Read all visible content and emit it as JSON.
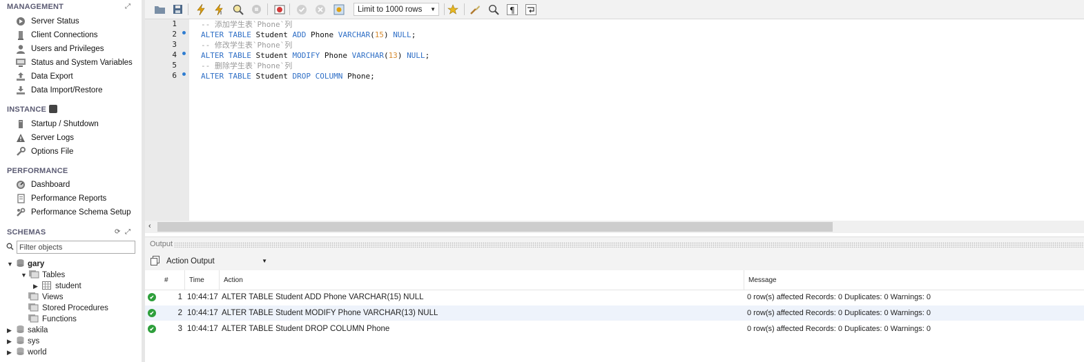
{
  "sidebar": {
    "management": {
      "title": "MANAGEMENT",
      "items": [
        "Server Status",
        "Client Connections",
        "Users and Privileges",
        "Status and System Variables",
        "Data Export",
        "Data Import/Restore"
      ]
    },
    "instance": {
      "title": "INSTANCE",
      "items": [
        "Startup / Shutdown",
        "Server Logs",
        "Options File"
      ]
    },
    "performance": {
      "title": "PERFORMANCE",
      "items": [
        "Dashboard",
        "Performance Reports",
        "Performance Schema Setup"
      ]
    },
    "schemas": {
      "title": "SCHEMAS",
      "filter_placeholder": "Filter objects",
      "tree": {
        "schema_gary": "gary",
        "tables": "Tables",
        "table_student": "student",
        "views": "Views",
        "stored_procedures": "Stored Procedures",
        "functions": "Functions",
        "schema_sakila": "sakila",
        "schema_sys": "sys",
        "schema_world": "world"
      }
    }
  },
  "toolbar": {
    "limit_label": "Limit to 1000 rows"
  },
  "editor": {
    "line_numbers": [
      "1",
      "2",
      "3",
      "4",
      "5",
      "6"
    ],
    "lines": [
      {
        "comment": "-- 添加学生表`Phone`列"
      },
      {
        "kw1": "ALTER TABLE",
        "id1": " Student ",
        "kw2": "ADD",
        "id2": " Phone ",
        "kw3": "VARCHAR",
        "p1": "(",
        "num": "15",
        "p2": ") ",
        "kw4": "NULL",
        "end": ";"
      },
      {
        "comment": "-- 修改学生表`Phone`列"
      },
      {
        "kw1": "ALTER TABLE",
        "id1": " Student ",
        "kw2": "MODIFY",
        "id2": " Phone ",
        "kw3": "VARCHAR",
        "p1": "(",
        "num": "13",
        "p2": ") ",
        "kw4": "NULL",
        "end": ";"
      },
      {
        "comment": "-- 删除学生表`Phone`列"
      },
      {
        "kw1": "ALTER TABLE",
        "id1": " Student ",
        "kw2": "DROP COLUMN",
        "id2": " Phone;"
      }
    ]
  },
  "output": {
    "panel_label": "Output",
    "selector_value": "Action Output",
    "columns": [
      "#",
      "Time",
      "Action",
      "Message"
    ],
    "rows": [
      {
        "num": "1",
        "time": "10:44:17",
        "action": "ALTER TABLE Student ADD Phone VARCHAR(15) NULL",
        "message": "0 row(s) affected Records: 0  Duplicates: 0  Warnings: 0"
      },
      {
        "num": "2",
        "time": "10:44:17",
        "action": "ALTER TABLE Student MODIFY Phone VARCHAR(13) NULL",
        "message": "0 row(s) affected Records: 0  Duplicates: 0  Warnings: 0"
      },
      {
        "num": "3",
        "time": "10:44:17",
        "action": "ALTER TABLE Student DROP COLUMN Phone",
        "message": "0 row(s) affected Records: 0  Duplicates: 0  Warnings: 0"
      }
    ]
  },
  "colors": {
    "keyword": "#2f6fc6",
    "number": "#d68a2f",
    "comment": "#9a9a9a",
    "success": "#2e9f3b",
    "section_title": "#5b5b73"
  }
}
